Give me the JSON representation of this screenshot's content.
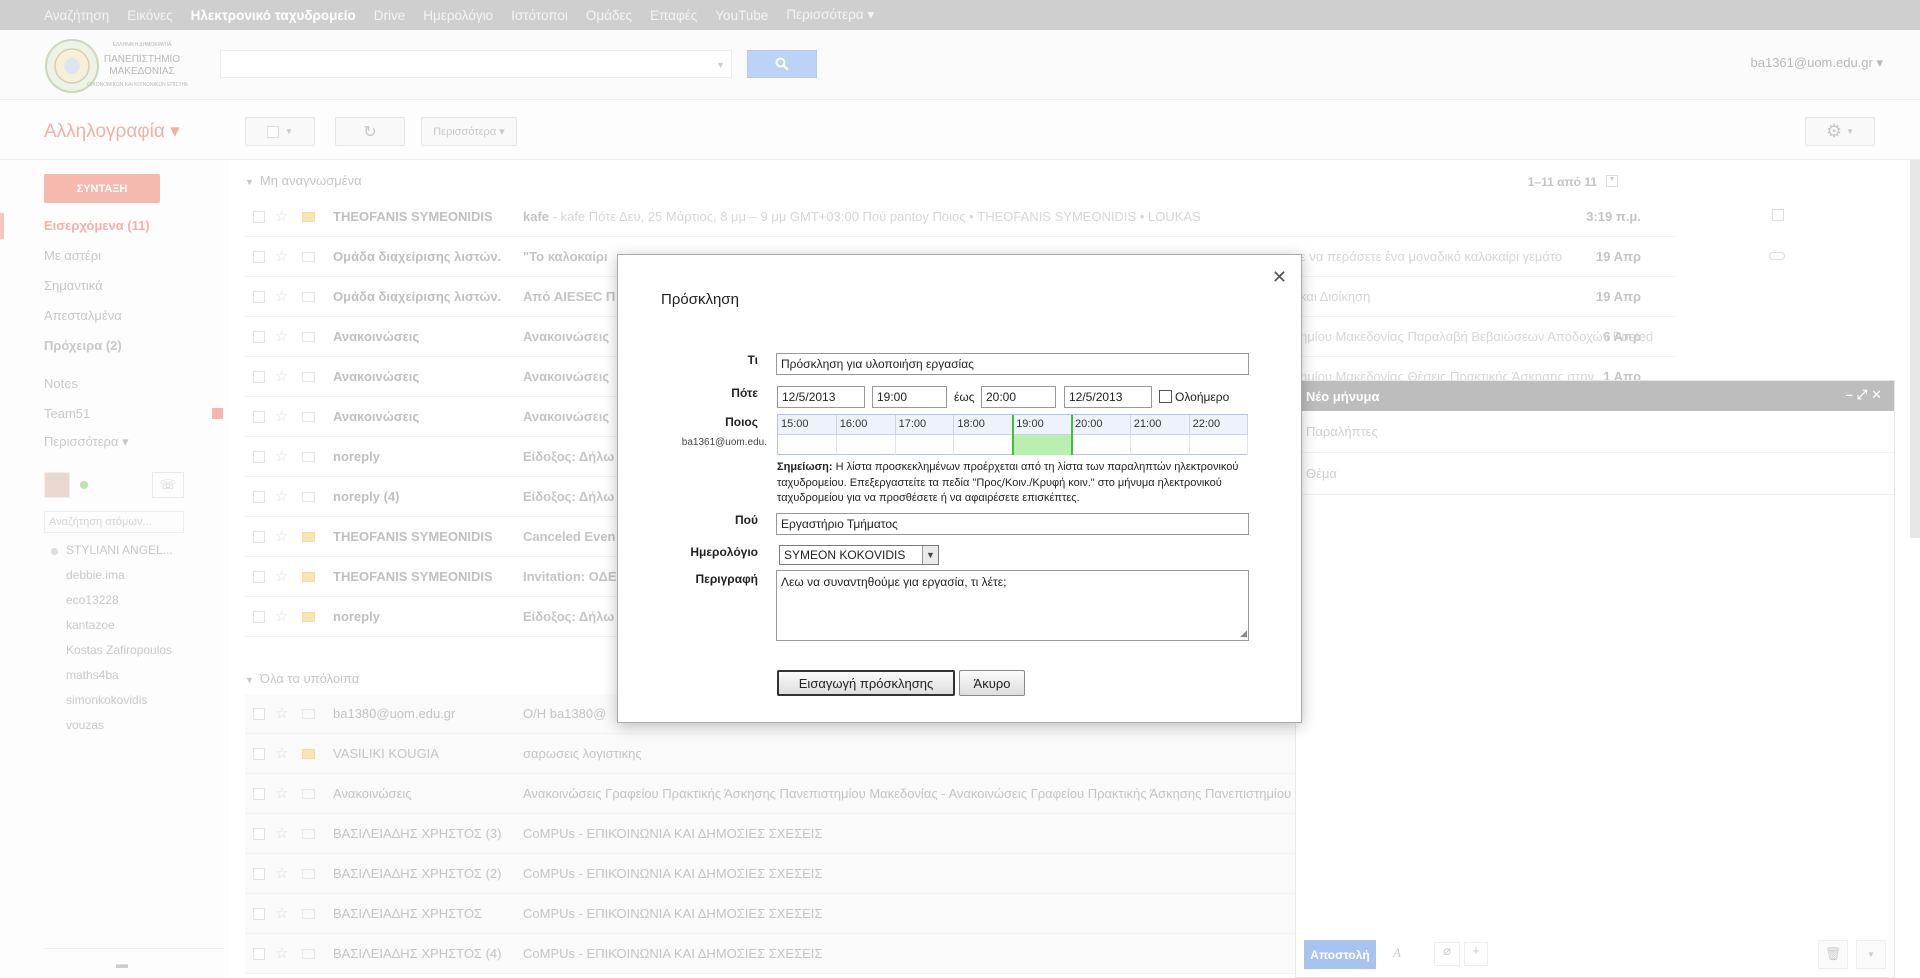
{
  "topbar": {
    "items": [
      "Αναζήτηση",
      "Εικόνες",
      "Ηλεκτρονικό ταχυδρομείο",
      "Drive",
      "Ημερολόγιο",
      "Ιστότοποι",
      "Ομάδες",
      "Επαφές",
      "YouTube",
      "Περισσότερα ▾"
    ]
  },
  "header": {
    "logo_lines": [
      "ΕΛΛΗΝΙΚΗ ΔΗΜΟΚΡΑΤΙΑ",
      "ΠΑΝΕΠΙΣΤΗΜΙΟ",
      "ΜΑΚΕΔΟΝΙΑΣ",
      "ΟΙΚΟΝΟΜΙΚΩΝ ΚΑΙ ΚΟΙΝΩΝΙΚΩΝ ΕΠΙΣΤΗΜΩΝ"
    ],
    "user_email": "ba1361@uom.edu.gr ▾"
  },
  "toolbar": {
    "mail_title": "Αλληλογραφία ▾",
    "more_label": "Περισσότερα ▾",
    "pagination": "1–11 από 11"
  },
  "leftnav": {
    "compose": "ΣΥΝΤΑΞΗ",
    "items": [
      "Εισερχόμενα (11)",
      "Με αστέρι",
      "Σημαντικά",
      "Απεσταλμένα",
      "Πρόχειρα (2)",
      "Notes",
      "Team51",
      "Περισσότερα ▾"
    ],
    "chat_search_placeholder": "Αναζήτηση ατόμων...",
    "contacts": [
      "STYLIANI ANGEL...",
      "debbie.ima",
      "eco13228",
      "kantazoe",
      "Kostas Zafiropoulos",
      "maths4ba",
      "simonkokovidis",
      "vouzas"
    ]
  },
  "maillist": {
    "unread_section": "Μη αναγνωσμένα",
    "all_section": "Όλα τα υπόλοιπα",
    "unread_rows": [
      {
        "sender": "THEOFANIS SYMEONIDIS",
        "subject": "kafe",
        "snippet": " - kafe Πότε Δευ, 25 Μάρτιος, 8 μμ – 9 μμ GMT+03:00 Πού pantoy Ποιος • THEOFANIS SYMEONIDIS • LOUKAS",
        "date": "3:19 π.μ."
      },
      {
        "sender": "Ομάδα διαχείρισης λιστών.",
        "subject": "\"Το καλοκαίρι",
        "snippet": "",
        "date": "19 Απρ"
      },
      {
        "sender": "Ομάδα διαχείρισης λιστών.",
        "subject": "Από AIESEC Π",
        "snippet": "",
        "date": "19 Απρ"
      },
      {
        "sender": "Ανακοινώσεις",
        "subject": "Ανακοινώσεις",
        "snippet": "",
        "date": "6 Απρ"
      },
      {
        "sender": "Ανακοινώσεις",
        "subject": "Ανακοινώσεις",
        "snippet": "",
        "date": "1 Απρ"
      },
      {
        "sender": "Ανακοινώσεις",
        "subject": "Ανακοινώσεις",
        "snippet": "",
        "date": ""
      },
      {
        "sender": "noreply",
        "subject": "Είδοξος: Δήλω",
        "snippet": "",
        "date": ""
      },
      {
        "sender": "noreply (4)",
        "subject": "Είδοξος: Δήλω",
        "snippet": "",
        "date": ""
      },
      {
        "sender": "THEOFANIS SYMEONIDIS",
        "subject": "Canceled Even",
        "snippet": "",
        "date": ""
      },
      {
        "sender": "THEOFANIS SYMEONIDIS",
        "subject": "Invitation: ΟΔΕ",
        "snippet": "",
        "date": ""
      },
      {
        "sender": "noreply",
        "subject": "Είδοξος: Δήλω",
        "snippet": "",
        "date": ""
      }
    ],
    "right_snippets": [
      "ε να περάσετε ένα μοναδικό καλοκαίρι γεμάτο",
      "και Διοίκηση",
      "ημίου Μακεδονίας Παραλαβή Βεβαιώσεων Αποδοχών Posted",
      "ημίου Μακεδονίας Θέσεις Πρακτικής Άσκησης στην"
    ],
    "all_rows": [
      {
        "sender": "ba1380@uom.edu.gr",
        "subject": "O/H ba1380@"
      },
      {
        "sender": "VASILIKI KOUGIA",
        "subject": "σαρωσεις λογιστικης"
      },
      {
        "sender": "Ανακοινώσεις",
        "subject": "Ανακοινώσεις Γραφείου Πρακτικής Άσκησης Πανεπιστημίου Μακεδονίας - Ανακοινώσεις Γραφείου Πρακτικής Άσκησης Πανεπιστημίου Μ"
      },
      {
        "sender": "ΒΑΣΙΛΕΙΑΔΗΣ ΧΡΗΣΤΟΣ (3)",
        "subject": "CoMPUs - ΕΠΙΚΟΙΝΩΝΙΑ ΚΑΙ ΔΗΜΟΣΙΕΣ ΣΧΕΣΕΙΣ"
      },
      {
        "sender": "ΒΑΣΙΛΕΙΑΔΗΣ ΧΡΗΣΤΟΣ (2)",
        "subject": "CoMPUs - ΕΠΙΚΟΙΝΩΝΙΑ ΚΑΙ ΔΗΜΟΣΙΕΣ ΣΧΕΣΕΙΣ"
      },
      {
        "sender": "ΒΑΣΙΛΕΙΑΔΗΣ ΧΡΗΣΤΟΣ",
        "subject": "CoMPUs - ΕΠΙΚΟΙΝΩΝΙΑ ΚΑΙ ΔΗΜΟΣΙΕΣ ΣΧΕΣΕΙΣ"
      },
      {
        "sender": "ΒΑΣΙΛΕΙΑΔΗΣ ΧΡΗΣΤΟΣ (4)",
        "subject": "CoMPUs - ΕΠΙΚΟΙΝΩΝΙΑ ΚΑΙ ΔΗΜΟΣΙΕΣ ΣΧΕΣΕΙΣ"
      }
    ]
  },
  "compose": {
    "title": "Νέο μήνυμα",
    "to_placeholder": "Παραλήπτες",
    "subject_placeholder": "Θέμα",
    "send": "Αποστολή"
  },
  "dialog": {
    "title": "Πρόσκληση",
    "what_label": "Τι",
    "what_value": "Πρόσκληση για υλοποιήση εργασίας",
    "when_label": "Πότε",
    "start_date": "12/5/2013",
    "start_time": "19:00",
    "until_label": "έως",
    "end_time": "20:00",
    "end_date": "12/5/2013",
    "allday_label": "Ολοήμερο",
    "who_label": "Ποιος",
    "who_email": "ba1361@uom.edu.",
    "hours": [
      "15:00",
      "16:00",
      "17:00",
      "18:00",
      "19:00",
      "20:00",
      "21:00",
      "22:00"
    ],
    "note_bold": "Σημείωση:",
    "note_text": " Η λίστα προσκεκλημένων προέρχεται από τη λίστα των παραληπτών ηλεκτρονικού ταχυδρομείου. Επεξεργαστείτε τα πεδία \"Προς/Κοιν./Κρυφή κοιν.\" στο μήνυμα ηλεκτρονικού ταχυδρομείου για να προσθέσετε ή να αφαιρέσετε επισκέπτες.",
    "where_label": "Πού",
    "where_value": "Εργαστήριο Τμήματος",
    "calendar_label": "Ημερολόγιο",
    "calendar_value": "SYMEON KOKOVIDIS",
    "desc_label": "Περιγραφή",
    "desc_value": "Λεω να συναντηθούμε για εργασία, τι λέτε;",
    "insert_btn": "Εισαγωγή πρόσκλησης",
    "cancel_btn": "Άκυρο"
  }
}
